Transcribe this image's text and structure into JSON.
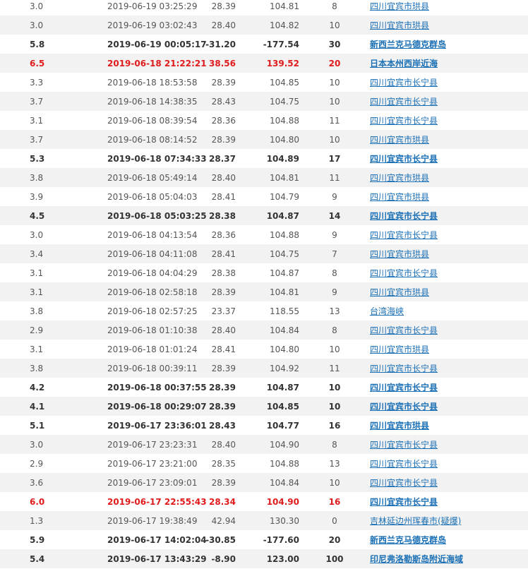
{
  "rows": [
    {
      "mag": "3.0",
      "time": "2019-06-19 03:25:29",
      "lat": "28.39",
      "lon": "104.81",
      "depth": "8",
      "loc": "四川宜宾市珙县",
      "style": "normal"
    },
    {
      "mag": "3.0",
      "time": "2019-06-19 03:02:43",
      "lat": "28.40",
      "lon": "104.82",
      "depth": "10",
      "loc": "四川宜宾市珙县",
      "style": "normal"
    },
    {
      "mag": "5.8",
      "time": "2019-06-19 00:05:17",
      "lat": "-31.20",
      "lon": "-177.54",
      "depth": "30",
      "loc": "新西兰克马德克群岛",
      "style": "bold"
    },
    {
      "mag": "6.5",
      "time": "2019-06-18 21:22:21",
      "lat": "38.56",
      "lon": "139.52",
      "depth": "20",
      "loc": "日本本州西岸近海",
      "style": "red"
    },
    {
      "mag": "3.3",
      "time": "2019-06-18 18:53:58",
      "lat": "28.39",
      "lon": "104.85",
      "depth": "10",
      "loc": "四川宜宾市长宁县",
      "style": "normal"
    },
    {
      "mag": "3.7",
      "time": "2019-06-18 14:38:35",
      "lat": "28.43",
      "lon": "104.75",
      "depth": "10",
      "loc": "四川宜宾市长宁县",
      "style": "normal"
    },
    {
      "mag": "3.1",
      "time": "2019-06-18 08:39:54",
      "lat": "28.36",
      "lon": "104.88",
      "depth": "11",
      "loc": "四川宜宾市长宁县",
      "style": "normal"
    },
    {
      "mag": "3.7",
      "time": "2019-06-18 08:14:52",
      "lat": "28.39",
      "lon": "104.80",
      "depth": "10",
      "loc": "四川宜宾市珙县",
      "style": "normal"
    },
    {
      "mag": "5.3",
      "time": "2019-06-18 07:34:33",
      "lat": "28.37",
      "lon": "104.89",
      "depth": "17",
      "loc": "四川宜宾市长宁县",
      "style": "bold"
    },
    {
      "mag": "3.8",
      "time": "2019-06-18 05:49:14",
      "lat": "28.40",
      "lon": "104.81",
      "depth": "11",
      "loc": "四川宜宾市珙县",
      "style": "normal"
    },
    {
      "mag": "3.9",
      "time": "2019-06-18 05:04:03",
      "lat": "28.41",
      "lon": "104.79",
      "depth": "9",
      "loc": "四川宜宾市珙县",
      "style": "normal"
    },
    {
      "mag": "4.5",
      "time": "2019-06-18 05:03:25",
      "lat": "28.38",
      "lon": "104.87",
      "depth": "14",
      "loc": "四川宜宾市长宁县",
      "style": "bold"
    },
    {
      "mag": "3.0",
      "time": "2019-06-18 04:13:54",
      "lat": "28.36",
      "lon": "104.88",
      "depth": "9",
      "loc": "四川宜宾市长宁县",
      "style": "normal"
    },
    {
      "mag": "3.4",
      "time": "2019-06-18 04:11:08",
      "lat": "28.41",
      "lon": "104.75",
      "depth": "7",
      "loc": "四川宜宾市珙县",
      "style": "normal"
    },
    {
      "mag": "3.1",
      "time": "2019-06-18 04:04:29",
      "lat": "28.38",
      "lon": "104.87",
      "depth": "8",
      "loc": "四川宜宾市长宁县",
      "style": "normal"
    },
    {
      "mag": "3.1",
      "time": "2019-06-18 02:58:18",
      "lat": "28.39",
      "lon": "104.81",
      "depth": "9",
      "loc": "四川宜宾市珙县",
      "style": "normal"
    },
    {
      "mag": "3.8",
      "time": "2019-06-18 02:57:25",
      "lat": "23.37",
      "lon": "118.55",
      "depth": "13",
      "loc": "台湾海峡",
      "style": "normal"
    },
    {
      "mag": "2.9",
      "time": "2019-06-18 01:10:38",
      "lat": "28.40",
      "lon": "104.84",
      "depth": "8",
      "loc": "四川宜宾市长宁县",
      "style": "normal"
    },
    {
      "mag": "3.1",
      "time": "2019-06-18 01:01:24",
      "lat": "28.41",
      "lon": "104.80",
      "depth": "10",
      "loc": "四川宜宾市珙县",
      "style": "normal"
    },
    {
      "mag": "3.8",
      "time": "2019-06-18 00:39:11",
      "lat": "28.39",
      "lon": "104.92",
      "depth": "11",
      "loc": "四川宜宾市长宁县",
      "style": "normal"
    },
    {
      "mag": "4.2",
      "time": "2019-06-18 00:37:55",
      "lat": "28.39",
      "lon": "104.87",
      "depth": "10",
      "loc": "四川宜宾市长宁县",
      "style": "bold"
    },
    {
      "mag": "4.1",
      "time": "2019-06-18 00:29:07",
      "lat": "28.39",
      "lon": "104.85",
      "depth": "10",
      "loc": "四川宜宾市长宁县",
      "style": "bold"
    },
    {
      "mag": "5.1",
      "time": "2019-06-17 23:36:01",
      "lat": "28.43",
      "lon": "104.77",
      "depth": "16",
      "loc": "四川宜宾市珙县",
      "style": "bold"
    },
    {
      "mag": "3.0",
      "time": "2019-06-17 23:23:31",
      "lat": "28.40",
      "lon": "104.90",
      "depth": "8",
      "loc": "四川宜宾市长宁县",
      "style": "normal"
    },
    {
      "mag": "2.9",
      "time": "2019-06-17 23:21:00",
      "lat": "28.35",
      "lon": "104.88",
      "depth": "13",
      "loc": "四川宜宾市长宁县",
      "style": "normal"
    },
    {
      "mag": "3.6",
      "time": "2019-06-17 23:09:01",
      "lat": "28.39",
      "lon": "104.84",
      "depth": "10",
      "loc": "四川宜宾市长宁县",
      "style": "normal"
    },
    {
      "mag": "6.0",
      "time": "2019-06-17 22:55:43",
      "lat": "28.34",
      "lon": "104.90",
      "depth": "16",
      "loc": "四川宜宾市长宁县",
      "style": "red"
    },
    {
      "mag": "1.3",
      "time": "2019-06-17 19:38:49",
      "lat": "42.94",
      "lon": "130.30",
      "depth": "0",
      "loc": "吉林延边州珲春市(疑爆)",
      "style": "normal"
    },
    {
      "mag": "5.9",
      "time": "2019-06-17 14:02:04",
      "lat": "-30.85",
      "lon": "-177.60",
      "depth": "20",
      "loc": "新西兰克马德克群岛",
      "style": "bold"
    },
    {
      "mag": "5.4",
      "time": "2019-06-17 13:43:29",
      "lat": "-8.90",
      "lon": "123.00",
      "depth": "100",
      "loc": "印尼弗洛勒斯岛附近海域",
      "style": "bold"
    }
  ]
}
